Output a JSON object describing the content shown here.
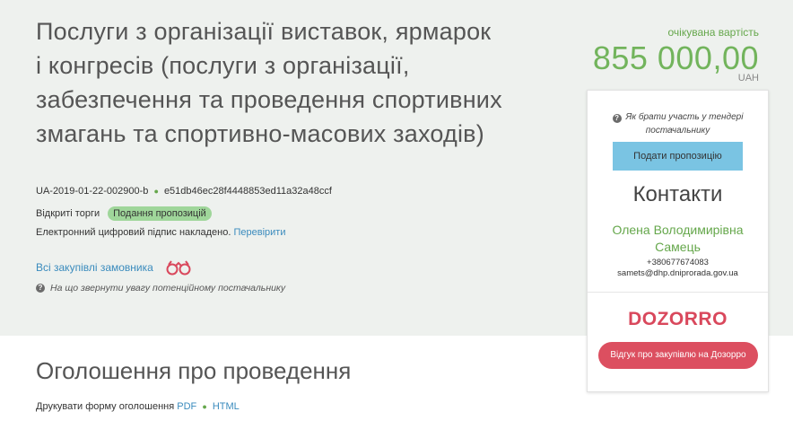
{
  "tender": {
    "title": "Послуги з організації виставок, ярмарок і конгресів (послуги з організації, забезпечення та проведення спортивних змагань та спортивно-масових заходів)",
    "id": "UA-2019-01-22-002900-b",
    "hash": "e51db46ec28f4448853ed11a32a48ccf",
    "procedure": "Відкриті торги",
    "status_badge": "Подання пропозицій",
    "signature_text": "Електронний цифровий підпис накладено.",
    "signature_link": "Перевірити",
    "all_purchases_link": "Всі закупівлі замовника",
    "hint": "На що звернути увагу потенційному постачальнику"
  },
  "expected": {
    "label": "очікувана вартість",
    "value": "855 000,00",
    "currency": "UAH"
  },
  "sidebar": {
    "participate_hint": "Як брати участь у тендері постачальнику",
    "offer_button": "Подати пропозицію",
    "contacts_title": "Контакти",
    "contact_name": "Олена Володимирівна Самець",
    "contact_phone": "+380677674083",
    "contact_email": "samets@dhp.dniprorada.gov.ua",
    "dozorro_logo": "DOZORRO",
    "dozorro_button": "Відгук про закупівлю на Дозорро"
  },
  "announcement": {
    "title": "Оголошення про проведення",
    "print_label": "Друкувати форму оголошення",
    "pdf_link": "PDF",
    "html_link": "HTML"
  },
  "colors": {
    "hero_bg": "#eef1ee",
    "accent_green": "#72b45c",
    "button_blue": "#7ac4e3",
    "dozorro_red": "#dc4f60",
    "link_blue": "#3a8bbd"
  },
  "icons": {
    "question": "question-circle-icon",
    "binoculars": "binoculars-icon"
  }
}
